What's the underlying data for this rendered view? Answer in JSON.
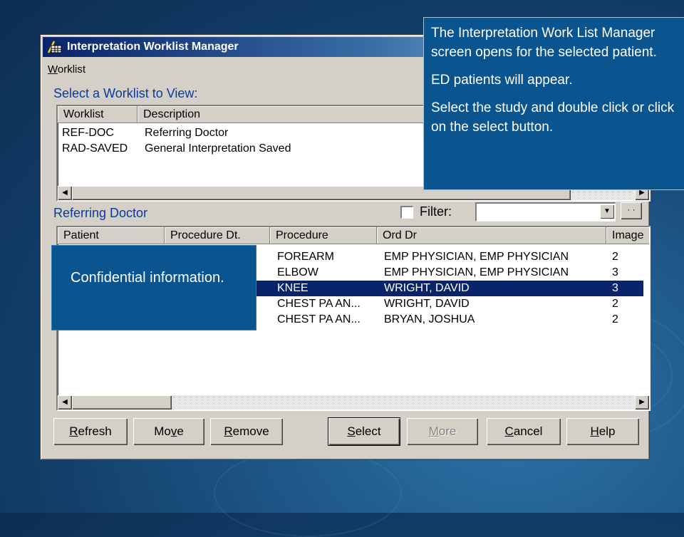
{
  "window": {
    "title": "Interpretation Worklist Manager",
    "menu": {
      "first": "W",
      "rest": "orklist"
    }
  },
  "worklists": {
    "label": "Select a Worklist to View:",
    "columns": [
      "Worklist",
      "Description"
    ],
    "rows": [
      {
        "worklist": "REF-DOC",
        "description": "Referring Doctor"
      },
      {
        "worklist": "RAD-SAVED",
        "description": "General Interpretation Saved"
      }
    ]
  },
  "studies": {
    "label": "Referring Doctor",
    "filter_label": "Filter:",
    "filter_value": "",
    "filter_checked": false,
    "more_button_label": "· ·",
    "columns": [
      "Patient",
      "Procedure Dt.",
      "Procedure",
      "Ord Dr",
      "Image"
    ],
    "rows": [
      {
        "procedure": "FOREARM",
        "ord_dr": "EMP PHYSICIAN, EMP PHYSICIAN",
        "images": "2",
        "selected": false
      },
      {
        "procedure": "ELBOW",
        "ord_dr": "EMP PHYSICIAN, EMP PHYSICIAN",
        "images": "3",
        "selected": false
      },
      {
        "procedure": "KNEE",
        "ord_dr": "WRIGHT, DAVID",
        "images": "3",
        "selected": true
      },
      {
        "procedure": "CHEST PA AN...",
        "ord_dr": "WRIGHT, DAVID",
        "images": "2",
        "selected": false
      },
      {
        "procedure": "CHEST PA AN...",
        "ord_dr": "BRYAN, JOSHUA",
        "images": "2",
        "selected": false
      }
    ]
  },
  "buttons": {
    "refresh": {
      "mnemonic": "R",
      "rest": "efresh"
    },
    "move": {
      "pre": "Mo",
      "mnemonic": "v",
      "post": "e"
    },
    "remove": {
      "mnemonic": "R",
      "rest": "emove"
    },
    "select": {
      "mnemonic": "S",
      "rest": "elect"
    },
    "more": {
      "mnemonic": "M",
      "rest": "ore",
      "disabled": true
    },
    "cancel": {
      "mnemonic": "C",
      "rest": "ancel"
    },
    "help": {
      "mnemonic": "H",
      "rest": "elp"
    }
  },
  "callouts": {
    "top": [
      "The Interpretation Work List Manager screen opens for the selected patient.",
      "ED patients will appear.",
      "Select the study and double click or click on the select button."
    ],
    "bottom": "Confidential information."
  },
  "colors": {
    "selection": "#0a246a",
    "section_label": "#0a3a9c",
    "callout_bg": "#0a5590"
  },
  "icons": {
    "window": "app-grid-icon",
    "scroll_left": "arrow-left-icon",
    "scroll_right": "arrow-right-icon",
    "dropdown": "chevron-down-icon"
  }
}
